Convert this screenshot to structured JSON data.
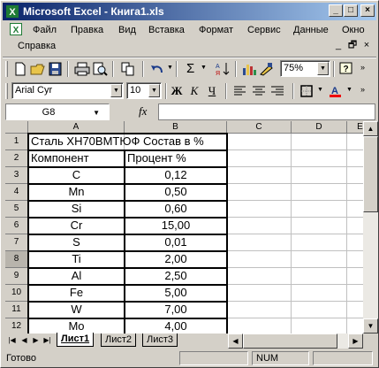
{
  "window": {
    "title": "Microsoft Excel - Книга1.xls"
  },
  "menu": {
    "items": [
      "Файл",
      "Правка",
      "Вид",
      "Вставка",
      "Формат",
      "Сервис",
      "Данные",
      "Окно",
      "Справка"
    ]
  },
  "toolbar": {
    "zoom": "75%",
    "font_name": "Arial Cyr",
    "font_size": "10",
    "bold": "Ж",
    "italic": "К",
    "underline": "Ч",
    "sum": "Σ"
  },
  "formula_bar": {
    "name_box": "G8",
    "fx": "fx",
    "formula": ""
  },
  "grid": {
    "columns": [
      "A",
      "B",
      "C",
      "D",
      "E"
    ],
    "rows": [
      "1",
      "2",
      "3",
      "4",
      "5",
      "6",
      "7",
      "8",
      "9",
      "10",
      "11",
      "12"
    ],
    "active_row": "8",
    "title_cell": "Сталь ХН70ВМТЮФ Состав в %",
    "headers": [
      "Компонент",
      "Процент %"
    ],
    "data": [
      [
        "C",
        "0,12"
      ],
      [
        "Mn",
        "0,50"
      ],
      [
        "Si",
        "0,60"
      ],
      [
        "Cr",
        "15,00"
      ],
      [
        "S",
        "0,01"
      ],
      [
        "Ti",
        "2,00"
      ],
      [
        "Al",
        "2,50"
      ],
      [
        "Fe",
        "5,00"
      ],
      [
        "W",
        "7,00"
      ],
      [
        "Mo",
        "4,00"
      ]
    ]
  },
  "sheets": [
    "Лист1",
    "Лист2",
    "Лист3"
  ],
  "status": {
    "text": "Готово",
    "num": "NUM"
  }
}
